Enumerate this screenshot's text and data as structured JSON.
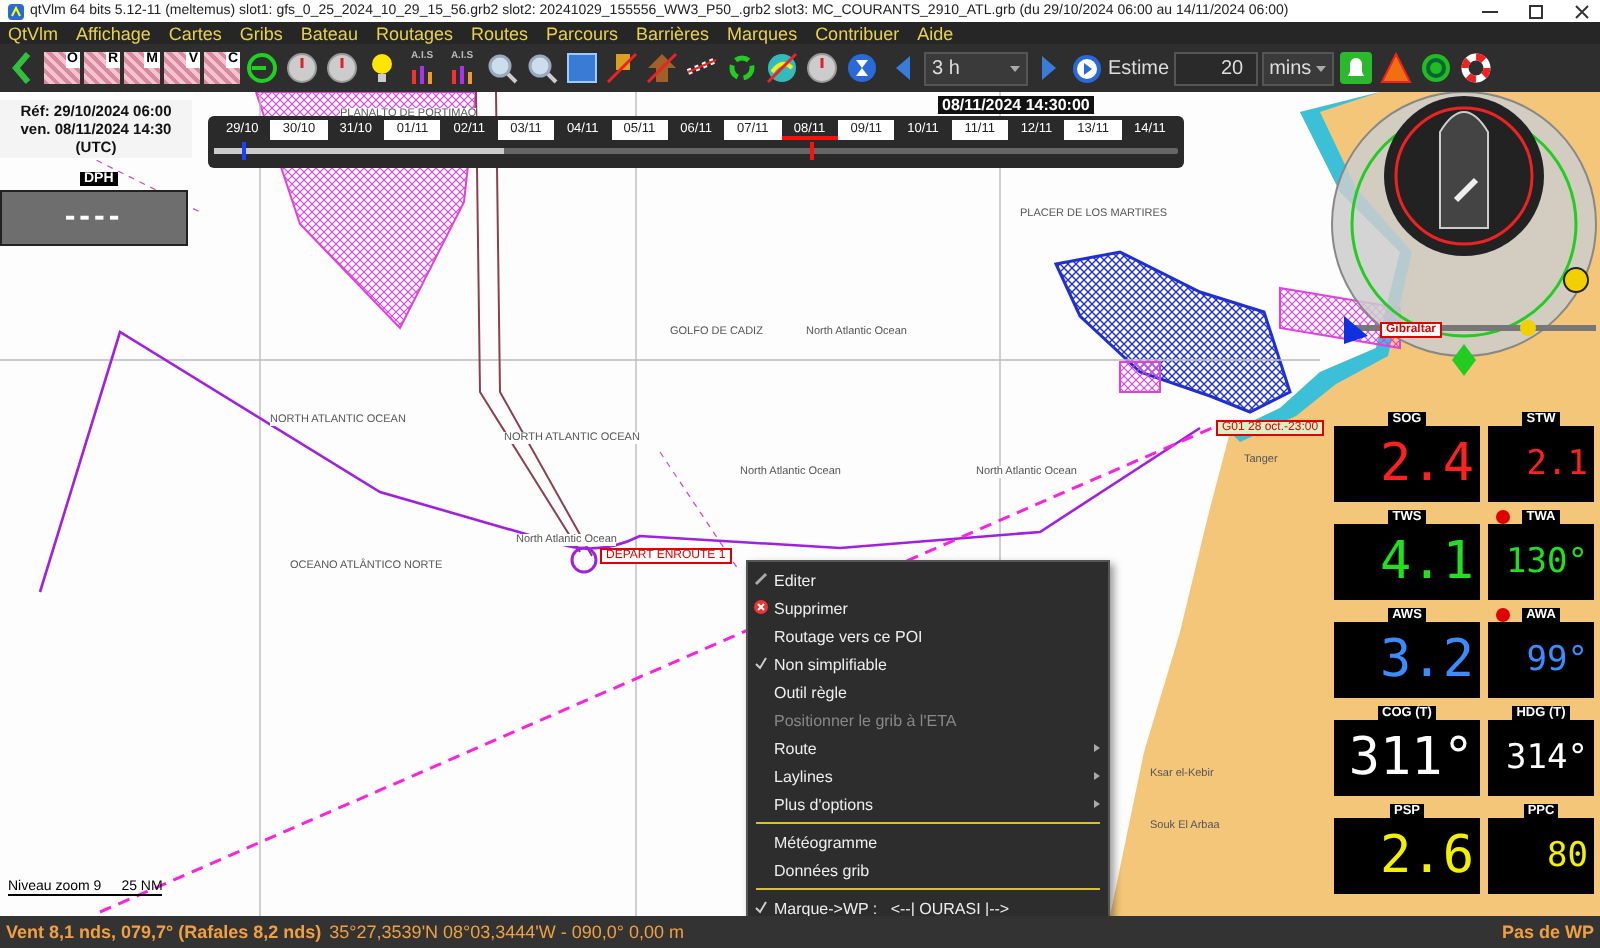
{
  "window": {
    "title": "qtVlm 64 bits 5.12-11 (meltemus) slot1: gfs_0_25_2024_10_29_15_56.grb2 slot2: 20241029_155556_WW3_P50_.grb2 slot3: MC_COURANTS_2910_ATL.grb (du 29/10/2024 06:00 au 14/11/2024 06:00)"
  },
  "menu": [
    "QtVlm",
    "Affichage",
    "Cartes",
    "Gribs",
    "Bateau",
    "Routages",
    "Routes",
    "Parcours",
    "Barrières",
    "Marques",
    "Contribuer",
    "Aide"
  ],
  "toolbar": {
    "items": [
      {
        "kind": "back"
      },
      {
        "kind": "thumb",
        "label": "O"
      },
      {
        "kind": "thumb",
        "label": "R"
      },
      {
        "kind": "thumb",
        "label": "M"
      },
      {
        "kind": "thumb",
        "label": "V"
      },
      {
        "kind": "thumb",
        "label": "C"
      },
      {
        "kind": "ring"
      },
      {
        "kind": "clock"
      },
      {
        "kind": "clock"
      },
      {
        "kind": "bulb"
      },
      {
        "kind": "ais",
        "label": "A.I.S"
      },
      {
        "kind": "ais",
        "label": "A.I.S"
      },
      {
        "kind": "zoom"
      },
      {
        "kind": "zoom"
      },
      {
        "kind": "square"
      },
      {
        "kind": "flag"
      },
      {
        "kind": "arrow"
      },
      {
        "kind": "rope"
      },
      {
        "kind": "recycle"
      },
      {
        "kind": "globe"
      },
      {
        "kind": "clock"
      },
      {
        "kind": "hourglass"
      }
    ],
    "step": "3 h",
    "estimate_button": "Estime",
    "estimate_value": "20",
    "estimate_unit": "mins"
  },
  "timeline": {
    "title": "08/11/2024 14:30:00",
    "level": 0.3,
    "dates": [
      {
        "label": "29/10",
        "selected": false
      },
      {
        "label": "30/10",
        "selected": false
      },
      {
        "label": "31/10",
        "selected": false
      },
      {
        "label": "01/11",
        "selected": false
      },
      {
        "label": "02/11",
        "selected": false
      },
      {
        "label": "03/11",
        "selected": false
      },
      {
        "label": "04/11",
        "selected": false
      },
      {
        "label": "05/11",
        "selected": false
      },
      {
        "label": "06/11",
        "selected": false
      },
      {
        "label": "07/11",
        "selected": false
      },
      {
        "label": "08/11",
        "selected": true
      },
      {
        "label": "09/11",
        "selected": false
      },
      {
        "label": "10/11",
        "selected": false
      },
      {
        "label": "11/11",
        "selected": false
      },
      {
        "label": "12/11",
        "selected": false
      },
      {
        "label": "13/11",
        "selected": false
      },
      {
        "label": "14/11",
        "selected": false
      }
    ]
  },
  "date_panel": {
    "reference": "Réf: 29/10/2024 06:00",
    "current": "ven. 08/11/2024 14:30",
    "zone": "(UTC)",
    "gauge_label": "DPH",
    "gauge_value": "----"
  },
  "map_labels": [
    "PLANALTO DE PORTIMÃO",
    "PLACER DE LOS MARTIRES",
    "GOLFO DE CADIZ",
    "North Atlantic Ocean",
    "NORTH ATLANTIC OCEAN",
    "NORTH ATLANTIC OCEAN",
    "North Atlantic Ocean",
    "North Atlantic Ocean",
    "North Atlantic Ocean",
    "OCEANO ATLÂNTICO NORTE",
    "Tanger",
    "Ksar el-Kebir",
    "Souk El Arbaa"
  ],
  "marks": [
    {
      "text": "DEPART ENROUTE 1",
      "kind": "start"
    },
    {
      "text": "G01 28 oct.-23:00",
      "kind": "waypoint"
    },
    {
      "text": "Gibraltar",
      "kind": "place"
    }
  ],
  "scale": {
    "zoom": "Niveau zoom 9",
    "distance": "25 NM"
  },
  "context_menu": [
    {
      "kind": "edit",
      "text": "Editer",
      "checked": false,
      "disabled": false,
      "submenu": false
    },
    {
      "kind": "delete",
      "text": "Supprimer",
      "checked": false,
      "disabled": false,
      "submenu": false
    },
    {
      "kind": "item",
      "text": "Routage vers ce POI",
      "checked": false,
      "disabled": false,
      "submenu": false
    },
    {
      "kind": "item",
      "text": "Non simplifiable",
      "checked": true,
      "disabled": false,
      "submenu": false
    },
    {
      "kind": "item",
      "text": "Outil règle",
      "checked": false,
      "disabled": false,
      "submenu": false
    },
    {
      "kind": "item",
      "text": "Positionner le grib à l'ETA",
      "checked": false,
      "disabled": true,
      "submenu": false
    },
    {
      "kind": "item",
      "text": "Route",
      "checked": false,
      "disabled": false,
      "submenu": true
    },
    {
      "kind": "item",
      "text": "Laylines",
      "checked": false,
      "disabled": false,
      "submenu": true
    },
    {
      "kind": "item",
      "text": "Plus d'options",
      "checked": false,
      "disabled": false,
      "submenu": true
    },
    {
      "kind": "separator"
    },
    {
      "kind": "item",
      "text": "Météogramme",
      "checked": false,
      "disabled": false,
      "submenu": false
    },
    {
      "kind": "item",
      "text": "Données grib",
      "checked": false,
      "disabled": false,
      "submenu": false
    },
    {
      "kind": "separator"
    },
    {
      "kind": "item",
      "text": "Marque->WP :   <--| OURASI |-->",
      "checked": true,
      "disabled": false,
      "submenu": false
    }
  ],
  "instruments": [
    {
      "label": "SOG",
      "value": "2.4",
      "color": "#ff2020",
      "alarm": false
    },
    {
      "label": "STW",
      "value": "2.1",
      "color": "#ff2020",
      "alarm": false
    },
    {
      "label": "TWS",
      "value": "4.1",
      "color": "#20e020",
      "alarm": false
    },
    {
      "label": "TWA",
      "value": "130°",
      "color": "#20e020",
      "alarm": true
    },
    {
      "label": "AWS",
      "value": "3.2",
      "color": "#3a8cff",
      "alarm": false
    },
    {
      "label": "AWA",
      "value": "99°",
      "color": "#3a8cff",
      "alarm": true
    },
    {
      "label": "COG (T)",
      "value": "311°",
      "color": "#ffffff",
      "alarm": false
    },
    {
      "label": "HDG (T)",
      "value": "314°",
      "color": "#ffffff",
      "alarm": false
    },
    {
      "label": "PSP",
      "value": "2.6",
      "color": "#f0f000",
      "alarm": false
    },
    {
      "label": "PPC",
      "value": "80",
      "color": "#f0f000",
      "alarm": false
    }
  ],
  "status_bar": {
    "wind": "Vent 8,1 nds, 079,7° (Rafales 8,2 nds)",
    "position": "35°27,3539'N 08°03,3444'W - 090,0° 0,00 m",
    "waypoint": "Pas de WP"
  }
}
